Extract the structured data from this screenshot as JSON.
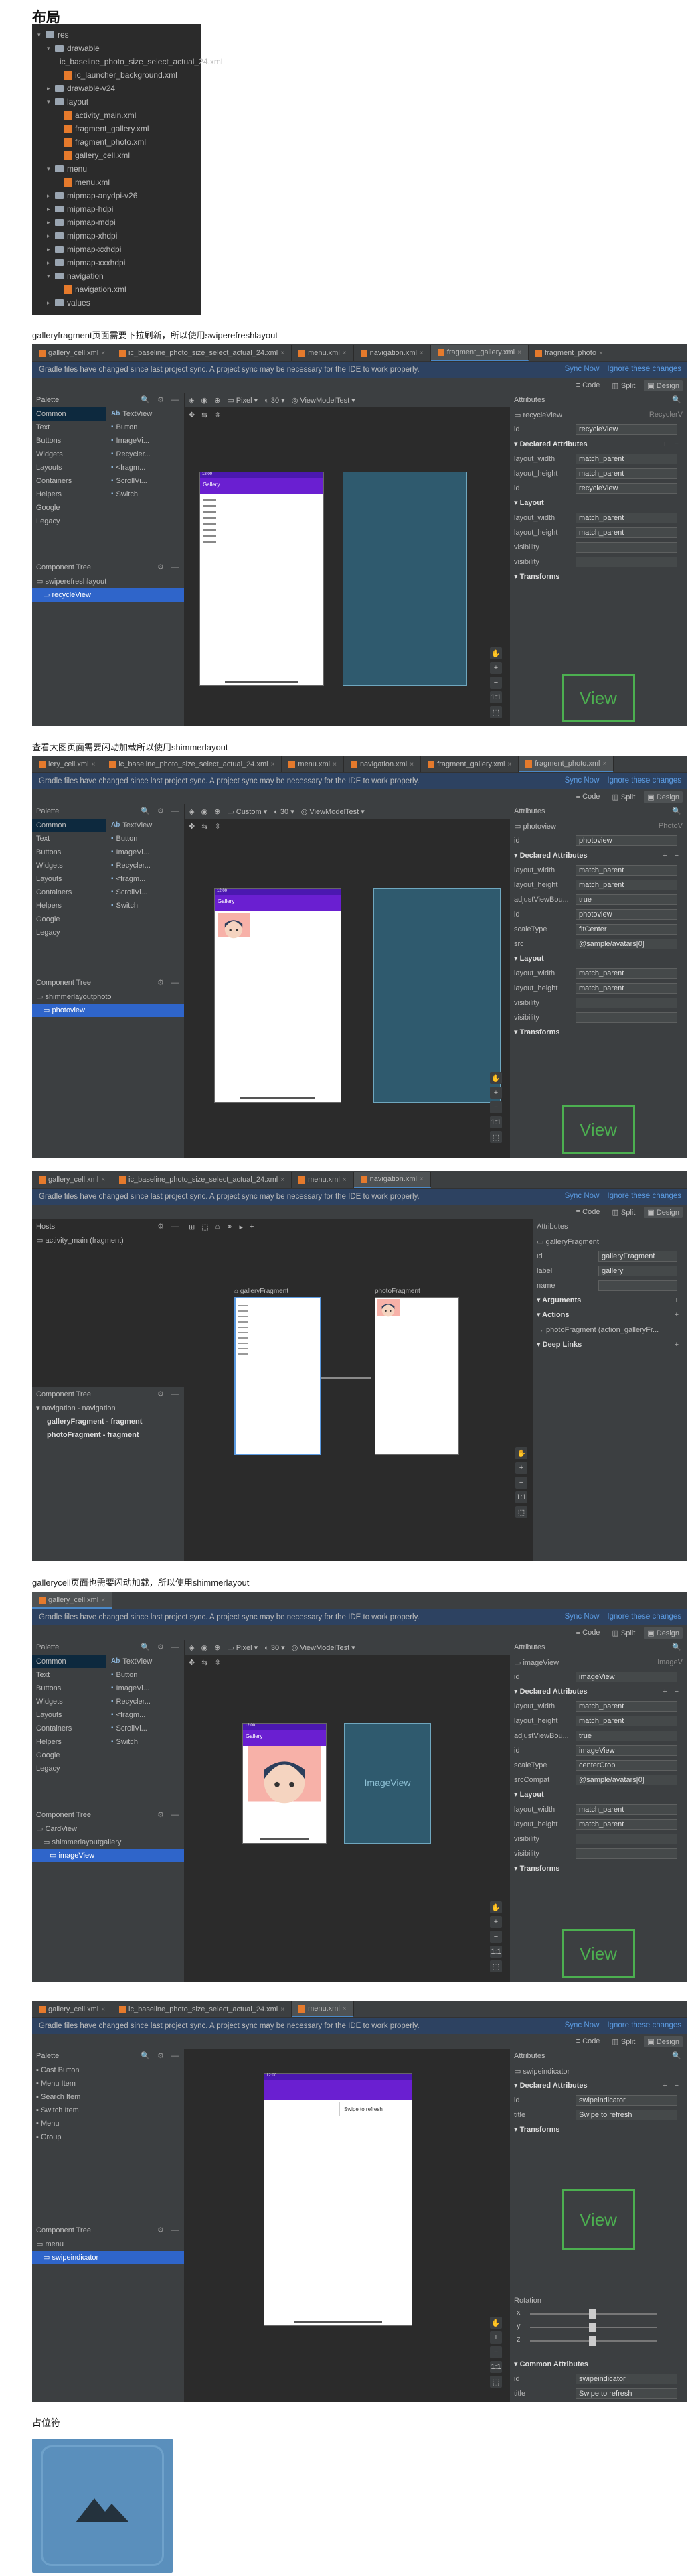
{
  "headings": {
    "layout": "布局",
    "placeholder": "占位符"
  },
  "captions": {
    "c1": "galleryfragment页面需要下拉刷新，所以使用swiperefreshlayout",
    "c2": "查看大图页面需要闪动加载所以使用shimmerlayout",
    "c3": "gallerycell页面也需要闪动加载，所以使用shimmerlayout"
  },
  "project_tree": [
    {
      "text": "res",
      "indent": 0,
      "kind": "folder",
      "open": true
    },
    {
      "text": "drawable",
      "indent": 1,
      "kind": "folder",
      "open": true
    },
    {
      "text": "ic_baseline_photo_size_select_actual_24.xml",
      "indent": 2,
      "kind": "xml"
    },
    {
      "text": "ic_launcher_background.xml",
      "indent": 2,
      "kind": "xml"
    },
    {
      "text": "drawable-v24",
      "indent": 1,
      "kind": "folder",
      "open": false
    },
    {
      "text": "layout",
      "indent": 1,
      "kind": "folder",
      "open": true
    },
    {
      "text": "activity_main.xml",
      "indent": 2,
      "kind": "xml"
    },
    {
      "text": "fragment_gallery.xml",
      "indent": 2,
      "kind": "xml"
    },
    {
      "text": "fragment_photo.xml",
      "indent": 2,
      "kind": "xml"
    },
    {
      "text": "gallery_cell.xml",
      "indent": 2,
      "kind": "xml"
    },
    {
      "text": "menu",
      "indent": 1,
      "kind": "folder",
      "open": true
    },
    {
      "text": "menu.xml",
      "indent": 2,
      "kind": "xml"
    },
    {
      "text": "mipmap-anydpi-v26",
      "indent": 1,
      "kind": "folder",
      "open": false
    },
    {
      "text": "mipmap-hdpi",
      "indent": 1,
      "kind": "folder",
      "open": false
    },
    {
      "text": "mipmap-mdpi",
      "indent": 1,
      "kind": "folder",
      "open": false
    },
    {
      "text": "mipmap-xhdpi",
      "indent": 1,
      "kind": "folder",
      "open": false
    },
    {
      "text": "mipmap-xxhdpi",
      "indent": 1,
      "kind": "folder",
      "open": false
    },
    {
      "text": "mipmap-xxxhdpi",
      "indent": 1,
      "kind": "folder",
      "open": false
    },
    {
      "text": "navigation",
      "indent": 1,
      "kind": "folder",
      "open": true
    },
    {
      "text": "navigation.xml",
      "indent": 2,
      "kind": "xml"
    },
    {
      "text": "values",
      "indent": 1,
      "kind": "folder",
      "open": false
    }
  ],
  "common": {
    "notice": "Gradle files have changed since last project sync. A project sync may be necessary for the IDE to work properly.",
    "sync_now": "Sync Now",
    "ignore": "Ignore these changes",
    "code": "Code",
    "split": "Split",
    "design": "Design",
    "palette": "Palette",
    "component_tree": "Component Tree",
    "attributes": "Attributes",
    "pixel": "Pixel",
    "api": "30",
    "viewmodel": "ViewModelTest",
    "custom": "Custom",
    "common_cat": "Common",
    "cats": [
      "Text",
      "Buttons",
      "Widgets",
      "Layouts",
      "Containers",
      "Helpers",
      "Google",
      "Legacy"
    ],
    "items": [
      "TextView",
      "Button",
      "ImageVi...",
      "Recycler...",
      "<fragm...",
      "ScrollVi...",
      "Switch"
    ],
    "declared": "Declared Attributes",
    "layout_sec": "Layout",
    "transforms": "Transforms",
    "view_label": "View",
    "gallery_title": "Gallery"
  },
  "s1": {
    "tabs": [
      "gallery_cell.xml",
      "ic_baseline_photo_size_select_actual_24.xml",
      "menu.xml",
      "navigation.xml",
      "fragment_gallery.xml",
      "fragment_photo"
    ],
    "active": 4,
    "tree": [
      "swiperefreshlayout",
      "recycleView"
    ],
    "attr_title": "recycleView",
    "attr_type": "RecyclerV",
    "id_label": "id",
    "id_value": "recycleView",
    "declared": [
      [
        "layout_width",
        "match_parent"
      ],
      [
        "layout_height",
        "match_parent"
      ],
      [
        "id",
        "recycleView"
      ]
    ],
    "layout": [
      [
        "layout_width",
        "match_parent"
      ],
      [
        "layout_height",
        "match_parent"
      ],
      [
        "visibility",
        ""
      ],
      [
        "visibility",
        ""
      ]
    ]
  },
  "s2": {
    "tabs": [
      "lery_cell.xml",
      "ic_baseline_photo_size_select_actual_24.xml",
      "menu.xml",
      "navigation.xml",
      "fragment_gallery.xml",
      "fragment_photo.xml"
    ],
    "active": 5,
    "tree": [
      "shimmerlayoutphoto",
      "photoview"
    ],
    "attr_title": "photoview",
    "attr_type": "PhotoV",
    "id_label": "id",
    "id_value": "photoview",
    "declared": [
      [
        "layout_width",
        "match_parent"
      ],
      [
        "layout_height",
        "match_parent"
      ],
      [
        "adjustViewBou...",
        "true"
      ],
      [
        "id",
        "photoview"
      ],
      [
        "scaleType",
        "fitCenter"
      ],
      [
        "src",
        "@sample/avatars[0]"
      ]
    ],
    "layout": [
      [
        "layout_width",
        "match_parent"
      ],
      [
        "layout_height",
        "match_parent"
      ],
      [
        "visibility",
        ""
      ],
      [
        "visibility",
        ""
      ]
    ]
  },
  "s3": {
    "tabs": [
      "gallery_cell.xml",
      "ic_baseline_photo_size_select_actual_24.xml",
      "menu.xml",
      "navigation.xml"
    ],
    "active": 3,
    "hosts": "Hosts",
    "host_item": "activity_main (fragment)",
    "tree": [
      "navigation - navigation",
      "galleryFragment - fragment",
      "photoFragment - fragment"
    ],
    "frag1": "galleryFragment",
    "frag2": "photoFragment",
    "attr_title": "galleryFragment",
    "rows": [
      [
        "id",
        "galleryFragment"
      ],
      [
        "label",
        "gallery"
      ],
      [
        "name",
        ""
      ]
    ],
    "arguments": "Arguments",
    "actions": "Actions",
    "action_item": "photoFragment (action_galleryFr...",
    "deeplinks": "Deep Links"
  },
  "s4": {
    "tabs": [
      "gallery_cell.xml"
    ],
    "active": 0,
    "tree": [
      "CardView",
      "shimmerlayoutgallery",
      "imageView"
    ],
    "attr_title": "imageView",
    "attr_type": "ImageV",
    "id_label": "id",
    "id_value": "imageView",
    "declared": [
      [
        "layout_width",
        "match_parent"
      ],
      [
        "layout_height",
        "match_parent"
      ],
      [
        "adjustViewBou...",
        "true"
      ],
      [
        "id",
        "imageView"
      ],
      [
        "scaleType",
        "centerCrop"
      ],
      [
        "srcCompat",
        "@sample/avatars[0]"
      ]
    ],
    "layout": [
      [
        "layout_width",
        "match_parent"
      ],
      [
        "layout_height",
        "match_parent"
      ],
      [
        "visibility",
        ""
      ],
      [
        "visibility",
        ""
      ]
    ],
    "blueprint_label": "ImageView"
  },
  "s5": {
    "tabs": [
      "gallery_cell.xml",
      "ic_baseline_photo_size_select_actual_24.xml",
      "menu.xml"
    ],
    "active": 2,
    "palette": [
      "Cast Button",
      "Menu Item",
      "Search Item",
      "Switch Item",
      "Menu",
      "Group"
    ],
    "tree": [
      "menu",
      "swipeindicator"
    ],
    "attr_title": "swipeindicator",
    "rows": [
      [
        "id",
        "swipeindicator"
      ],
      [
        "title",
        "Swipe to refresh"
      ]
    ],
    "popup": "Swipe to refresh",
    "rotation": "Rotation",
    "rot_axes": [
      "x",
      "y",
      "z"
    ],
    "common_attrs": "Common Attributes",
    "common_rows": [
      [
        "id",
        "swipeindicator"
      ],
      [
        "title",
        "Swipe to refresh"
      ]
    ],
    "time": "12:00"
  },
  "colors": {
    "accent": "#6a1fd1",
    "ide_bg": "#2b2b2b",
    "panel": "#3c3f41",
    "link": "#5b9ae0",
    "placeholder": "#5a8fbc"
  }
}
